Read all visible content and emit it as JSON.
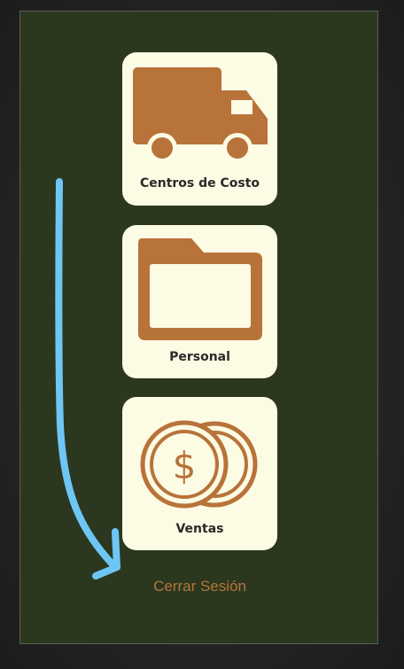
{
  "menu": {
    "items": [
      {
        "label": "Centros de Costo",
        "icon": "truck-icon"
      },
      {
        "label": "Personal",
        "icon": "folder-icon"
      },
      {
        "label": "Ventas",
        "icon": "coins-icon"
      }
    ],
    "logout_label": "Cerrar Sesión"
  },
  "colors": {
    "background": "#2b381f",
    "card": "#fcfbe4",
    "icon": "#b8733a",
    "logout_text": "#b5773a",
    "gesture": "#6ec6f5"
  }
}
